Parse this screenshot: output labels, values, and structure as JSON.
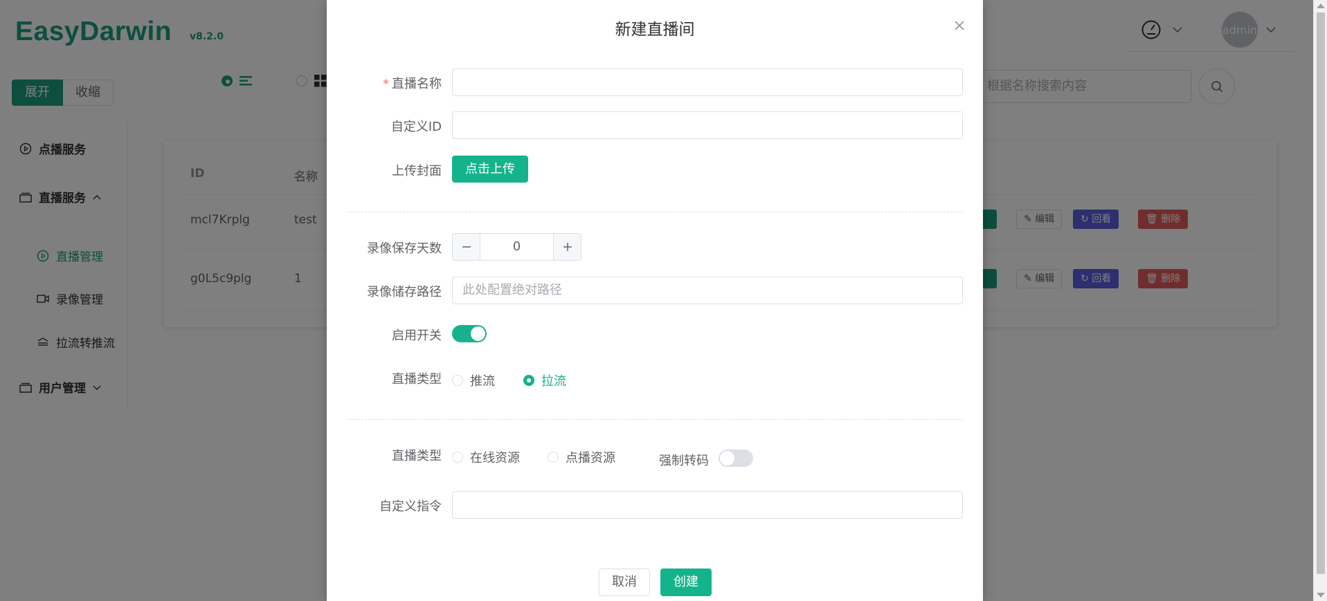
{
  "app": {
    "logo": "EasyDarwin",
    "version": "v8.2.0",
    "expand_label": "展开",
    "collapse_label": "收缩",
    "search_placeholder": "根据名称搜索内容",
    "avatar_text": "admin"
  },
  "sidebar": {
    "items": [
      {
        "label": "点播服务",
        "icon": "play-circle-icon"
      },
      {
        "label": "直播服务",
        "icon": "stack-icon"
      },
      {
        "label": "直播管理",
        "icon": "play-circle-icon"
      },
      {
        "label": "录像管理",
        "icon": "video-camera-icon"
      },
      {
        "label": "拉流转推流",
        "icon": "stream-arrows-icon"
      },
      {
        "label": "用户管理",
        "icon": "stack-icon"
      }
    ]
  },
  "table": {
    "headers": [
      "ID",
      "名称"
    ],
    "rows": [
      {
        "id": "mcl7Krplg",
        "name": "test"
      },
      {
        "id": "g0L5c9plg",
        "name": "1"
      }
    ],
    "actions": {
      "edit": "编辑",
      "playback": "回看",
      "delete": "删除"
    }
  },
  "dialog": {
    "title": "新建直播间",
    "fields": {
      "name_label": "直播名称",
      "name_value": "",
      "custom_id_label": "自定义ID",
      "custom_id_value": "",
      "cover_label": "上传封面",
      "upload_button": "点击上传",
      "record_days_label": "录像保存天数",
      "record_days_value": "0",
      "record_path_label": "录像储存路径",
      "record_path_placeholder": "此处配置绝对路径",
      "enable_label": "启用开关",
      "enabled": true,
      "live_type_label": "直播类型",
      "live_type_options": [
        "推流",
        "拉流"
      ],
      "live_type_selected": "拉流",
      "source_type_label": "直播类型",
      "source_type_options": [
        "在线资源",
        "点播资源"
      ],
      "force_transcode_label": "强制转码",
      "force_transcode": false,
      "custom_cmd_label": "自定义指令",
      "custom_cmd_value": ""
    },
    "cancel_button": "取消",
    "create_button": "创建"
  },
  "colors": {
    "brand": "#1a9c7f",
    "primary_button": "#15b38b",
    "danger": "#e05a5a",
    "accent_purple": "#5a5fe0"
  }
}
